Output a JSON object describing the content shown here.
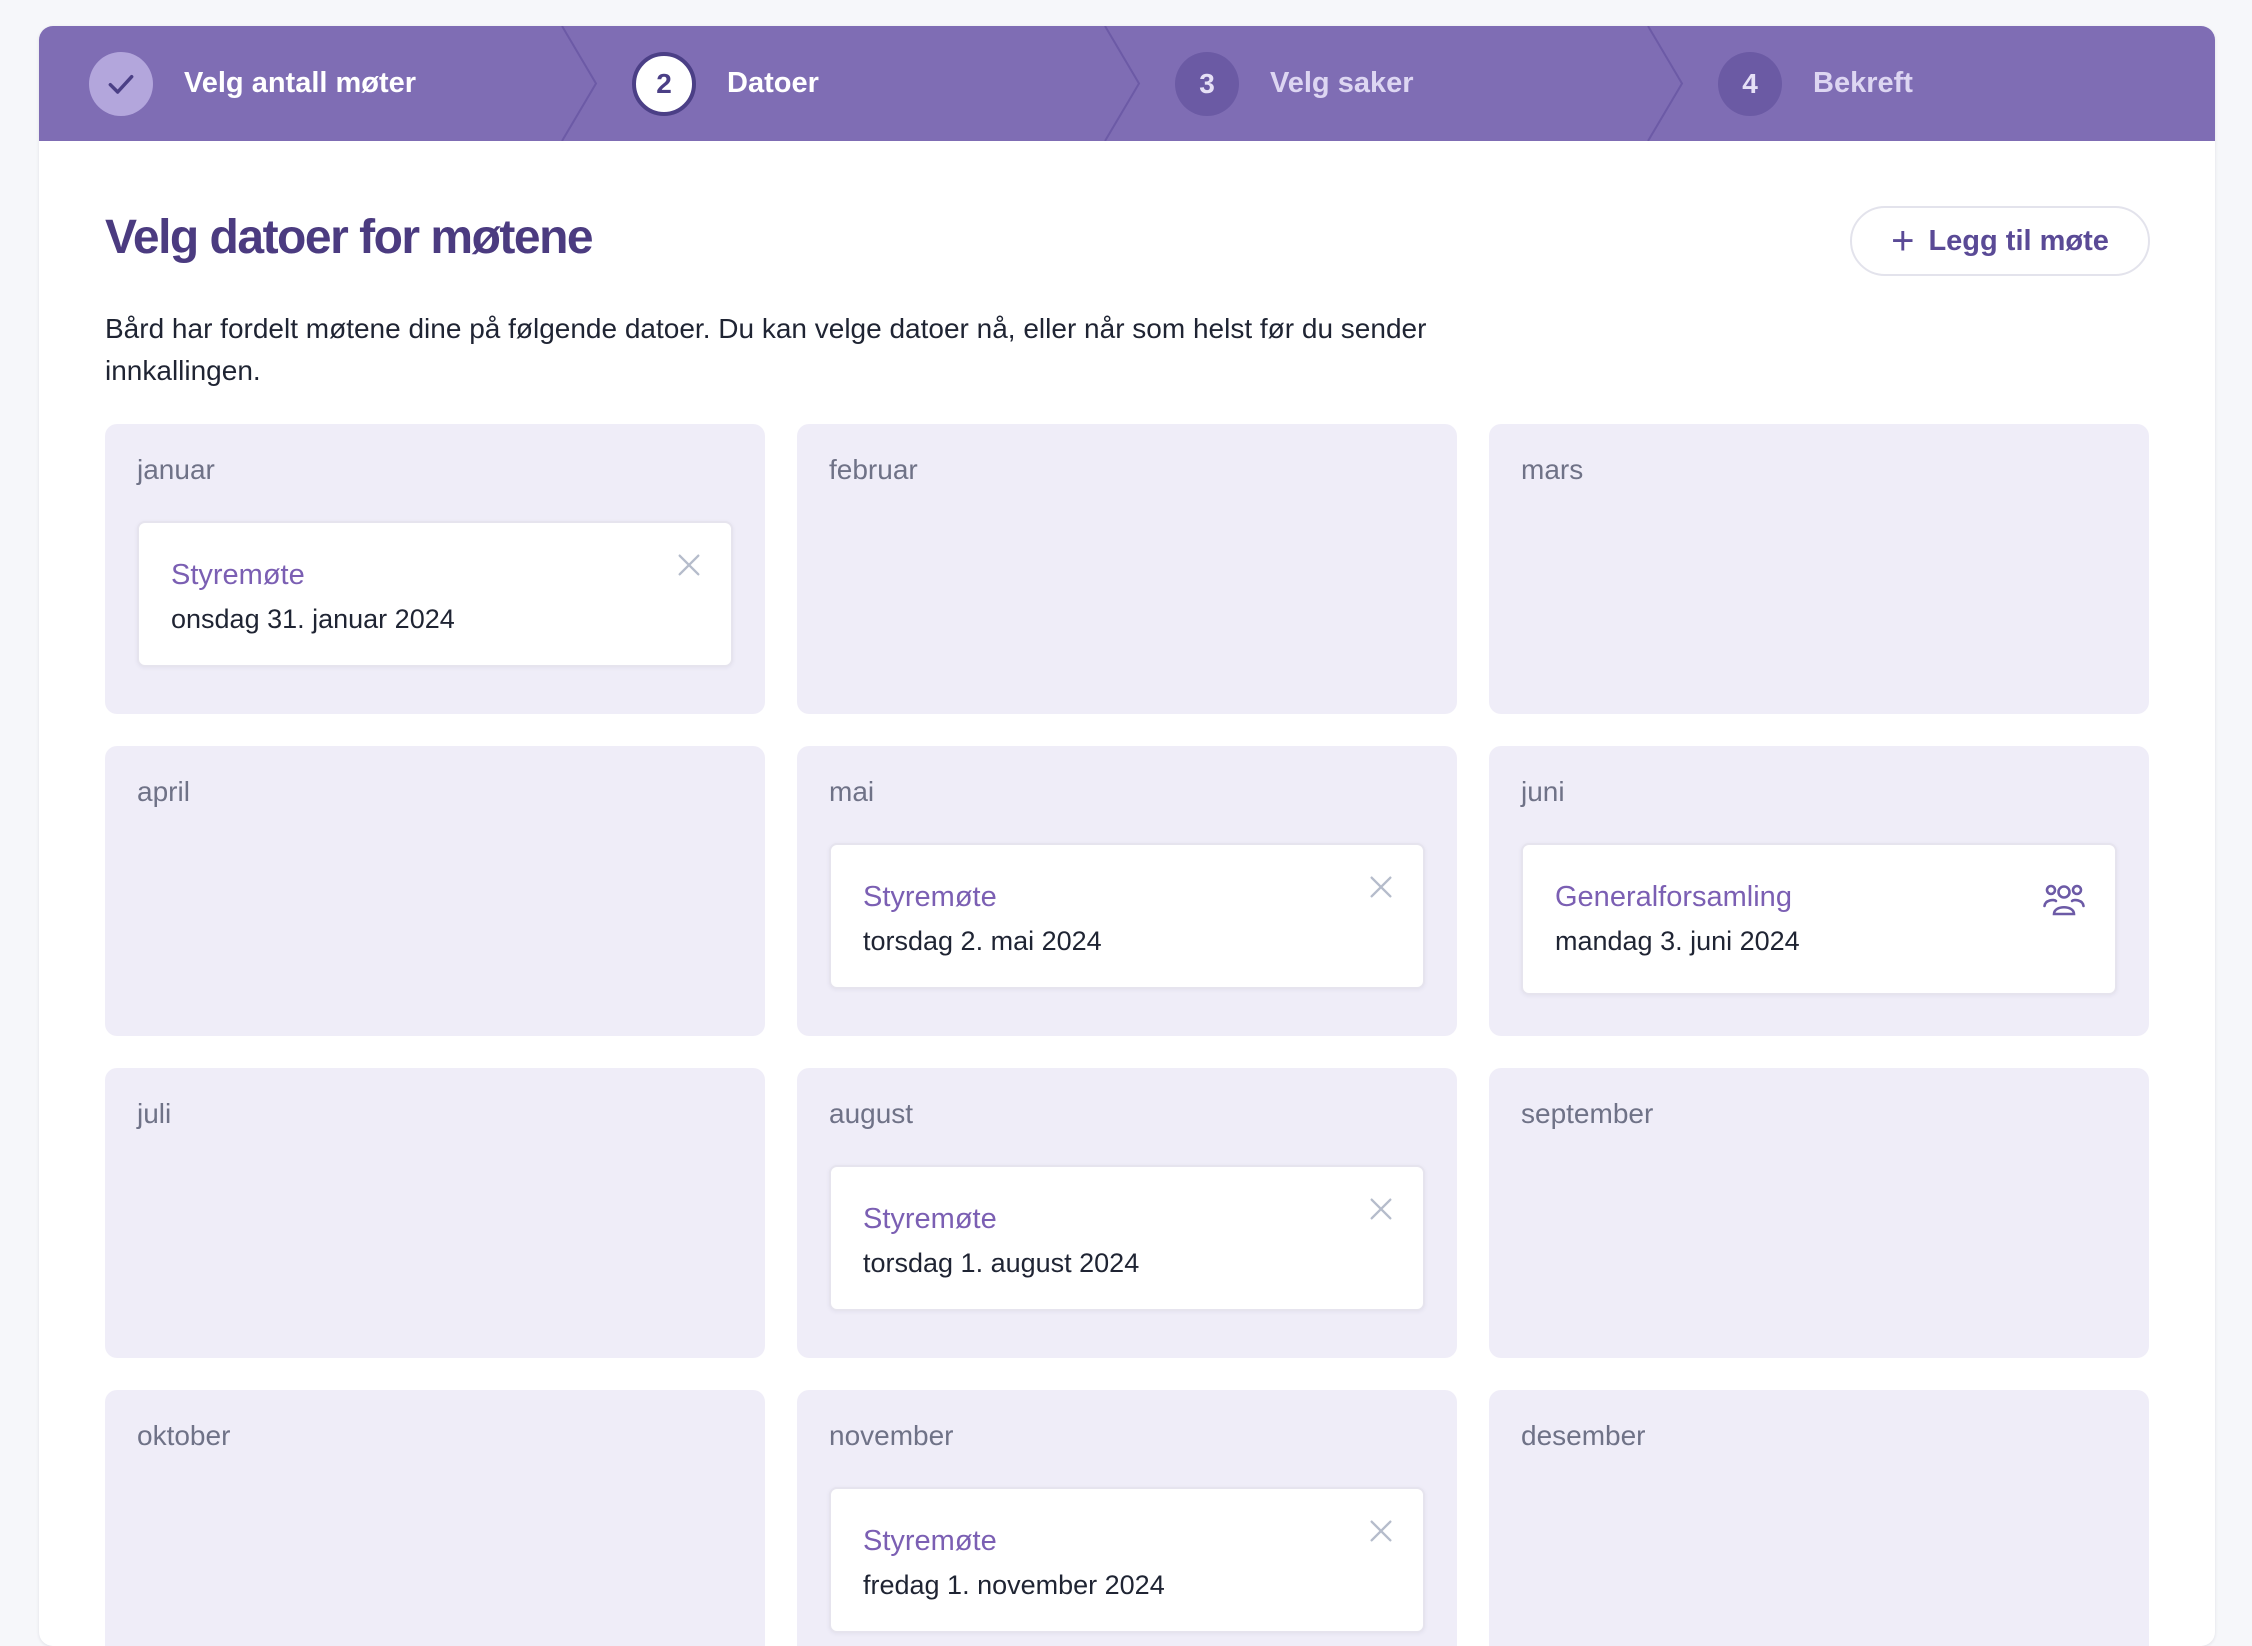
{
  "stepper": {
    "steps": [
      {
        "number": "",
        "label": "Velg antall møter",
        "state": "done"
      },
      {
        "number": "2",
        "label": "Datoer",
        "state": "current"
      },
      {
        "number": "3",
        "label": "Velg saker",
        "state": "todo"
      },
      {
        "number": "4",
        "label": "Bekreft",
        "state": "todo"
      }
    ]
  },
  "page": {
    "title": "Velg datoer for møtene",
    "add_button": "Legg til møte",
    "intro": "Bård har fordelt møtene dine på følgende datoer. Du kan velge datoer nå, eller når som helst før du sender innkallingen."
  },
  "months": [
    {
      "name": "januar",
      "meeting": {
        "title": "Styremøte",
        "date": "onsdag 31. januar 2024",
        "icon": "close-icon"
      }
    },
    {
      "name": "februar"
    },
    {
      "name": "mars"
    },
    {
      "name": "april"
    },
    {
      "name": "mai",
      "meeting": {
        "title": "Styremøte",
        "date": "torsdag 2. mai 2024",
        "icon": "close-icon"
      }
    },
    {
      "name": "juni",
      "meeting": {
        "title": "Generalforsamling",
        "date": "mandag 3. juni 2024",
        "icon": "group-icon"
      }
    },
    {
      "name": "juli"
    },
    {
      "name": "august",
      "meeting": {
        "title": "Styremøte",
        "date": "torsdag 1. august 2024",
        "icon": "close-icon"
      }
    },
    {
      "name": "september"
    },
    {
      "name": "oktober"
    },
    {
      "name": "november",
      "meeting": {
        "title": "Styremøte",
        "date": "fredag 1. november 2024",
        "icon": "close-icon"
      }
    },
    {
      "name": "desember"
    }
  ],
  "colors": {
    "brand": "#7f6db4",
    "title": "#4b3b80",
    "meeting_title": "#7b5fb3",
    "month_bg": "#efedf8"
  }
}
